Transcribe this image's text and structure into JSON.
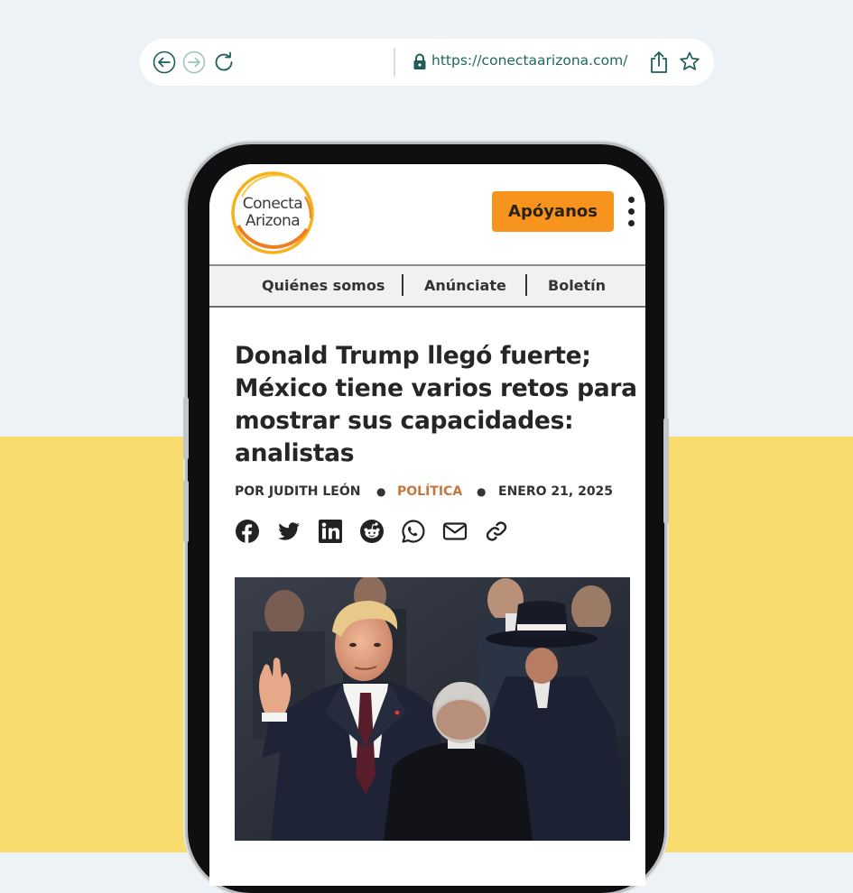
{
  "browser": {
    "url": "https://conectaarizona.com/"
  },
  "site": {
    "logo_line1": "Conecta",
    "logo_line2": "Arizona",
    "support_label": "Apóyanos",
    "nav": [
      "Quiénes somos",
      "Anúnciate",
      "Boletín"
    ]
  },
  "article": {
    "headline": "Donald Trump llegó fuerte; México tiene varios retos para mostrar sus capacidades: analistas",
    "author": "POR JUDITH LEÓN",
    "category": "POLÍTICA",
    "date": "ENERO 21, 2025",
    "separator": "●",
    "share_icons": [
      "facebook-icon",
      "twitter-icon",
      "linkedin-icon",
      "reddit-icon",
      "whatsapp-icon",
      "email-icon",
      "link-icon"
    ]
  },
  "colors": {
    "top_background": "#edf2f7",
    "bottom_background": "#f8dc6e",
    "support_button": "#f7941d",
    "category": "#c6773b",
    "url_text": "#1d6a5e"
  }
}
